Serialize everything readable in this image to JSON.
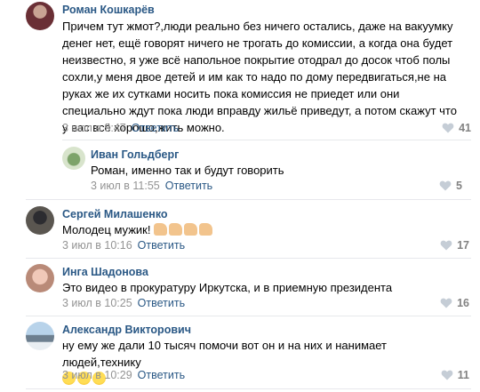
{
  "reply_label": "Ответить",
  "comments": [
    {
      "author": "Роман Кошкарёв",
      "text": "Причем тут жмот?,люди реально без ничего остались, даже на вакуумку денег нет, ещё говорят ничего не трогать до комиссии, а когда она будет неизвестно, я уже всё напольное покрытие отодрал до досок чтоб полы сохли,у меня двое детей и им как то надо по дому передвигаться,не на руках же их сутками носить пока комиссия не приедет или они специально ждут пока люди вправду жильё приведут, а потом скажут что у вас всё хорошо,жить можно.",
      "date": "3 июл в 9:47",
      "likes": "41"
    },
    {
      "author": "Иван Гольдберг",
      "text": "Роман, именно так и будут говорить",
      "date": "3 июл в 11:55",
      "likes": "5"
    },
    {
      "author": "Сергей Милашенко",
      "text": "Молодец мужик!",
      "date": "3 июл в 10:16",
      "likes": "17"
    },
    {
      "author": "Инга Шадонова",
      "text": "Это видео в прокуратуру Иркутска, и в приемную президента",
      "date": "3 июл в 10:25",
      "likes": "16"
    },
    {
      "author": "Александр Викторович",
      "text": "ну ему же дали 10 тысяч помочи вот он и на них и нанимает людей,технику",
      "date": "3 июл в 10:29",
      "likes": "11"
    }
  ],
  "icons": {
    "like": "heart-icon",
    "thumbs": "thumbs-up-emoji",
    "laugh": "laughing-emoji"
  },
  "colors": {
    "author": "#2a5885",
    "meta": "#939393",
    "like": "#828282",
    "separator": "#e7e8ec"
  }
}
